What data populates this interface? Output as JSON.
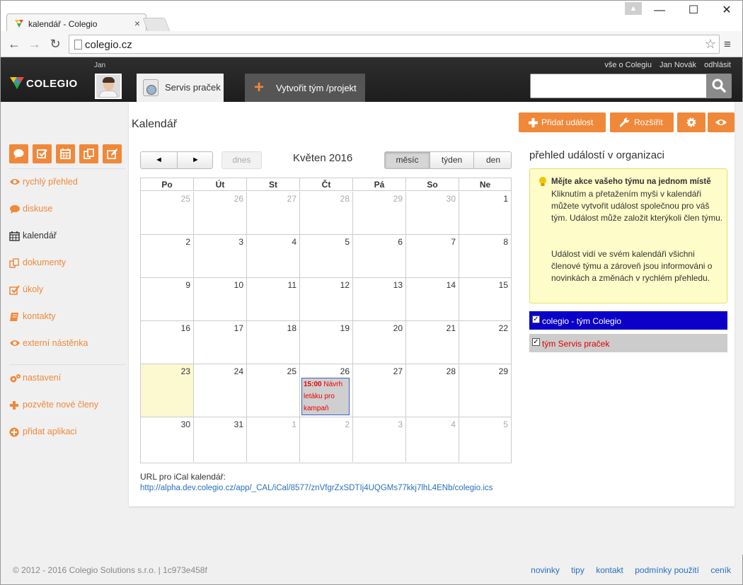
{
  "browser": {
    "tab_title": "kalendář - Colegio",
    "tab_close": "×",
    "url": "colegio.cz",
    "profile_glyph": "▲",
    "minimize": "—",
    "maximize": "☐",
    "close": "✕",
    "back": "←",
    "forward": "→",
    "reload": "↻",
    "star": "☆",
    "menu": "≡"
  },
  "header": {
    "logo_text": "COLEGIO",
    "user_first_name": "Jan",
    "team_tab_label": "Servis praček",
    "create_tab_plus": "+",
    "create_tab_label": "Vytvořit tým /projekt",
    "links": [
      "vše o Colegiu",
      "Jan Novák",
      "odhlásit"
    ],
    "search_value": ""
  },
  "sidebar": {
    "quick_icons": [
      "chat-icon",
      "check-icon",
      "calendar-icon",
      "documents-icon",
      "edit-icon"
    ],
    "nav": [
      {
        "label": "rychlý přehled",
        "icon": "eye-icon"
      },
      {
        "label": "diskuse",
        "icon": "chat-icon"
      },
      {
        "label": "kalendář",
        "icon": "calendar-icon",
        "active": true
      },
      {
        "label": "dokumenty",
        "icon": "documents-icon"
      },
      {
        "label": "úkoly",
        "icon": "check-icon"
      },
      {
        "label": "kontakty",
        "icon": "book-icon"
      },
      {
        "label": "externí nástěnka",
        "icon": "eye-icon"
      }
    ],
    "settings": [
      {
        "label": "nastavení",
        "icon": "gears-icon"
      },
      {
        "label": "pozvěte nové členy",
        "icon": "plus-icon"
      },
      {
        "label": "přidat aplikaci",
        "icon": "plus-circle-icon"
      }
    ]
  },
  "main": {
    "page_title": "Kalendář",
    "actions": {
      "add_event": "Přidat událost",
      "extend": "Rozšířit"
    },
    "calendar": {
      "prev": "◄",
      "next": "►",
      "today": "dnes",
      "month_title": "Květen 2016",
      "views": [
        "měsíc",
        "týden",
        "den"
      ],
      "active_view": "měsíc",
      "weekdays": [
        "Po",
        "Út",
        "St",
        "Čt",
        "Pá",
        "So",
        "Ne"
      ],
      "weeks": [
        [
          {
            "d": "25",
            "o": true
          },
          {
            "d": "26",
            "o": true
          },
          {
            "d": "27",
            "o": true
          },
          {
            "d": "28",
            "o": true
          },
          {
            "d": "29",
            "o": true
          },
          {
            "d": "30",
            "o": true
          },
          {
            "d": "1"
          }
        ],
        [
          {
            "d": "2"
          },
          {
            "d": "3"
          },
          {
            "d": "4"
          },
          {
            "d": "5"
          },
          {
            "d": "6"
          },
          {
            "d": "7"
          },
          {
            "d": "8"
          }
        ],
        [
          {
            "d": "9"
          },
          {
            "d": "10"
          },
          {
            "d": "11"
          },
          {
            "d": "12"
          },
          {
            "d": "13"
          },
          {
            "d": "14"
          },
          {
            "d": "15"
          }
        ],
        [
          {
            "d": "16"
          },
          {
            "d": "17"
          },
          {
            "d": "18"
          },
          {
            "d": "19"
          },
          {
            "d": "20"
          },
          {
            "d": "21"
          },
          {
            "d": "22"
          }
        ],
        [
          {
            "d": "23",
            "today": true
          },
          {
            "d": "24"
          },
          {
            "d": "25"
          },
          {
            "d": "26",
            "event": {
              "time": "15:00",
              "title": "Návrh letáku pro kampaň"
            }
          },
          {
            "d": "27"
          },
          {
            "d": "28"
          },
          {
            "d": "29"
          }
        ],
        [
          {
            "d": "30"
          },
          {
            "d": "31"
          },
          {
            "d": "1",
            "o": true
          },
          {
            "d": "2",
            "o": true
          },
          {
            "d": "3",
            "o": true
          },
          {
            "d": "4",
            "o": true
          },
          {
            "d": "5",
            "o": true
          }
        ]
      ]
    },
    "ical": {
      "label": "URL pro iCal kalendář:",
      "url": "http://alpha.dev.colegio.cz/app/_CAL/iCal/8577/znVfgrZxSDTIj4UQGMs77kkj7lhL4ENb/colegio.ics"
    },
    "overview": {
      "title": "přehled událostí v organizaci",
      "tip_title": "Mějte akce vašeho týmu na jednom místě",
      "tip_p1": "Kliknutím a přetažením myši v kalendáři můžete vytvořit událost společnou pro váš tým. Událost může založit kterýkoli člen týmu.",
      "tip_p2": "Událost vidí ve svém kalendáři všichni členové týmu a zároveň jsou informováni o novinkách a změnách v rychlém přehledu."
    },
    "calendars": [
      {
        "label": "colegio - tým Colegio",
        "checked": true,
        "bg": "#0c00c8",
        "fg": "#ffffff"
      },
      {
        "label": "tým Servis praček",
        "checked": true,
        "bg": "#cccccc",
        "fg": "#e00000"
      }
    ]
  },
  "footer": {
    "copyright": "© 2012 - 2016 Colegio Solutions s.r.o. | 1c973e458f",
    "links": [
      "novinky",
      "tipy",
      "kontakt",
      "podmínky použití",
      "ceník"
    ]
  },
  "colors": {
    "accent": "#f0883a",
    "header_bg": "#262626",
    "link": "#2a6fc0"
  }
}
